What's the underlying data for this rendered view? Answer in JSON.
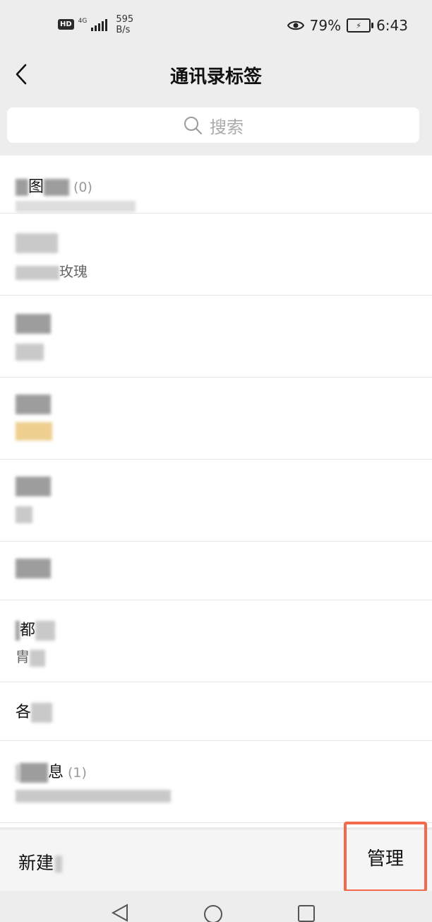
{
  "status_bar": {
    "hd": "HD",
    "network": "4G",
    "speed_value": "595",
    "speed_unit": "B/s",
    "battery": "79%",
    "time": "6:43"
  },
  "header": {
    "title": "通讯录标签"
  },
  "search": {
    "placeholder": "搜索"
  },
  "tags": [
    {
      "name_visible": "图",
      "count": "(0)",
      "subtitle": ""
    },
    {
      "name_visible": "",
      "count": "",
      "subtitle": "玫瑰"
    },
    {
      "name_visible": "",
      "count": "",
      "subtitle": ""
    },
    {
      "name_visible": "",
      "count": "",
      "subtitle": ""
    },
    {
      "name_visible": "",
      "count": "",
      "subtitle": ""
    },
    {
      "name_visible": "",
      "count": "",
      "subtitle": ""
    },
    {
      "name_visible": "都",
      "count": "",
      "subtitle": "胄"
    },
    {
      "name_visible": "各",
      "count": "",
      "subtitle": ""
    },
    {
      "name_visible": "息",
      "count": "(1)",
      "subtitle": ""
    }
  ],
  "bottom_bar": {
    "new_label": "新建",
    "manage_label": "管理"
  },
  "colors": {
    "highlight": "#f26a4b",
    "background": "#ededed"
  },
  "icons": [
    "back-arrow-icon",
    "search-icon",
    "eye-icon",
    "battery-icon",
    "nav-back-icon",
    "nav-home-icon",
    "nav-recents-icon"
  ]
}
